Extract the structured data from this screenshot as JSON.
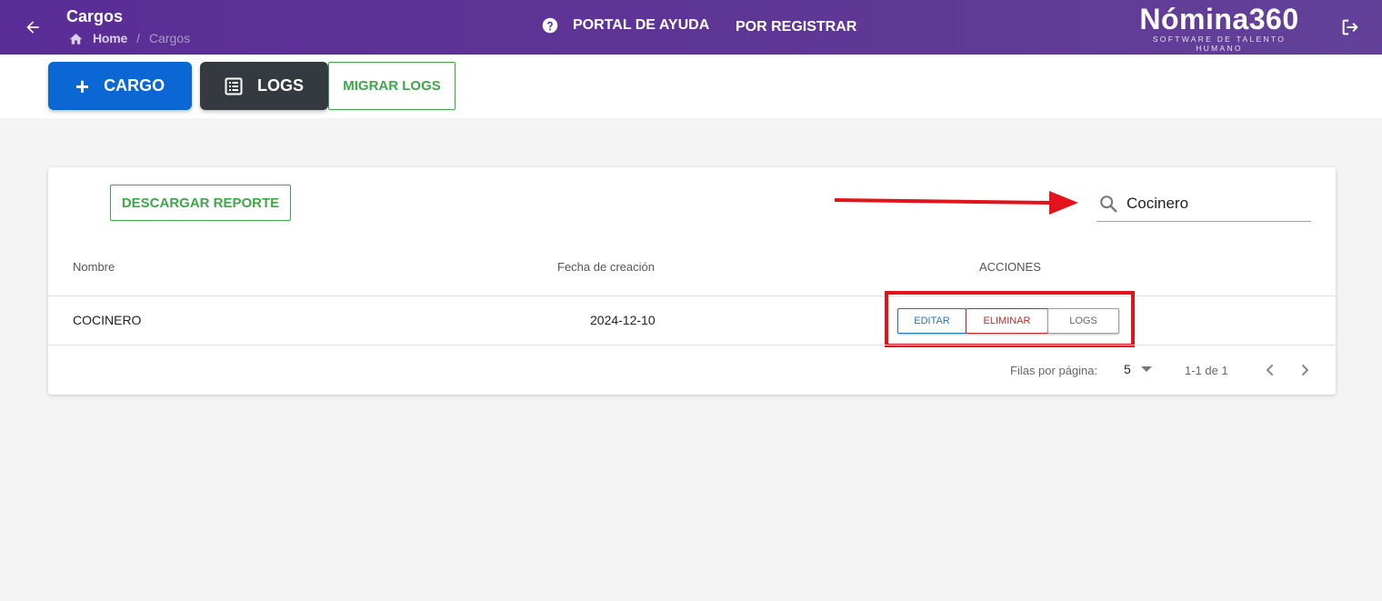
{
  "header": {
    "title": "Cargos",
    "breadcrumb": {
      "home": "Home",
      "separator": "/",
      "current": "Cargos"
    },
    "nav": {
      "help": "PORTAL DE AYUDA",
      "register": "POR REGISTRAR"
    },
    "brand": {
      "name": "Nómina360",
      "tagline": "SOFTWARE DE TALENTO HUMANO"
    },
    "icons": {
      "back": "arrow-left-icon",
      "home": "home-icon",
      "help": "help-circle-icon",
      "logout": "logout-icon"
    }
  },
  "toolbar": {
    "add_cargo": {
      "icon": "+",
      "label": "CARGO"
    },
    "logs": "LOGS",
    "migrar_logs": "MIGRAR LOGS"
  },
  "card": {
    "download_report": "DESCARGAR REPORTE",
    "search": {
      "value": "Cocinero",
      "placeholder": ""
    },
    "table": {
      "columns": [
        "Nombre",
        "Fecha de creación",
        "ACCIONES"
      ],
      "rows": [
        {
          "name": "COCINERO",
          "date": "2024-12-10",
          "actions": [
            "EDITAR",
            "ELIMINAR",
            "LOGS"
          ]
        }
      ]
    },
    "pagination": {
      "rows_per_page_label": "Filas por página:",
      "rows_per_page": "5",
      "range": "1-1 de 1"
    }
  },
  "colors": {
    "header": "#5f3796",
    "primary": "#0b67d4",
    "dark": "#343a40",
    "success": "#3fa64a",
    "danger": "#c62828",
    "annotation": "#e3131b"
  }
}
